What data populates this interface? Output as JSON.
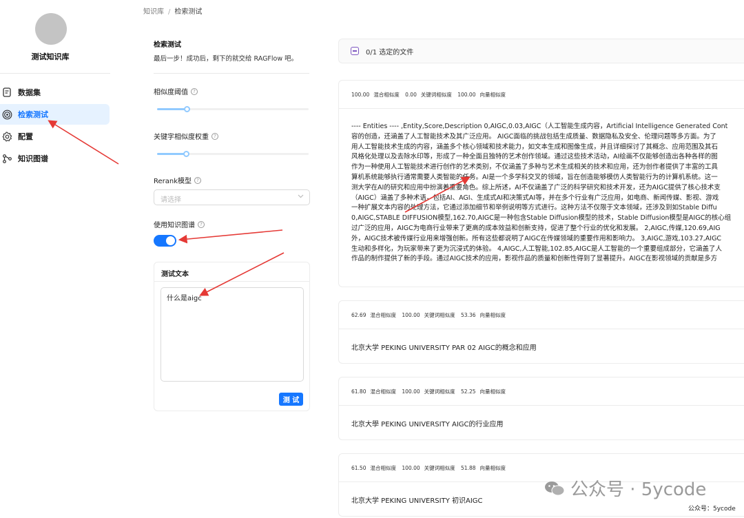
{
  "breadcrumb": {
    "root": "知识库",
    "separator": "/",
    "current": "检索测试"
  },
  "sidebar": {
    "kb_name": "测试知识库",
    "items": [
      {
        "label": "数据集",
        "icon": "document-icon",
        "active": false
      },
      {
        "label": "检索测试",
        "icon": "target-icon",
        "active": true
      },
      {
        "label": "配置",
        "icon": "gear-icon",
        "active": false
      },
      {
        "label": "知识图谱",
        "icon": "graph-icon",
        "active": false
      }
    ]
  },
  "panel": {
    "title": "检索测试",
    "subtitle": "最后一步！成功后，剩下的就交给 RAGFlow 吧。",
    "similarity_threshold_label": "相似度阈值",
    "similarity_threshold_value": 0.2,
    "keyword_weight_label": "关键字相似度权重",
    "keyword_weight_value": 0.2,
    "rerank_label": "Rerank模型",
    "rerank_placeholder": "请选择",
    "knowledge_graph_label": "使用知识图谱",
    "knowledge_graph_enabled": true,
    "test_text_title": "测试文本",
    "test_text_value": "什么是aigc",
    "test_button": "测 试",
    "help_icon": "?"
  },
  "results": {
    "selected_files": "0/1  选定的文件",
    "items": [
      {
        "hybrid": "100.00",
        "hybrid_label": "混合相似度",
        "keyword": "0.00",
        "keyword_label": "关键词相似度",
        "vector": "100.00",
        "vector_label": "向量相似度",
        "lines": [
          "---- Entities ---- ,Entity,Score,Description 0,AIGC,0.03,AIGC（人工智能生成内容，Artificial Intelligence Generated Cont",
          "容的创造，还涵盖了人工智能技术及其广泛应用。 AIGC面临的挑战包括生成质量、数据隐私及安全、伦理问题等多方面。为了",
          "用人工智能技术生成的内容，涵盖多个核心领域和技术能力，如文本生成和图像生成，并且详细探讨了其概念、应用范围及其石",
          "风格化处理以及去除水印等，形成了一种全面且独特的艺术创作领域。通过这些技术活动，AI绘画不仅能够创造出各种各样的图",
          "作为一种使用人工智能技术进行创作的艺术类别，不仅涵盖了多种与艺术生成相关的技术和应用，还为创作者提供了丰富的工具",
          "算机系统能够执行通常需要人类智能的任务。AI是一个多学科交叉的领域，旨在创造能够模仿人类智能行为的计算机系统。这一",
          "测大学在AI的研究和应用中扮演着重要角色。综上所述，AI不仅涵盖了广泛的科学研究和技术开发，还为AIGC提供了核心技术支",
          "（AIGC）涵盖了多种术语，包括AI、AGI、生成式AI和决策式AI等，并在多个行业有广泛应用，如电商、新闻传媒、影视、游戏",
          "一种扩展文本内容的处理方法，它通过添加细节和举例说明等方式进行。这种方法不仅限于文本领域，还涉及到如Stable Diffu",
          "0,AIGC,STABLE DIFFUSION模型,162.70,AIGC是一种包含Stable Diffusion模型的技术，Stable Diffusion模型是AIGC的核心组",
          "过广泛的应用，AIGC为电商行业带来了更高的成本效益和创新支持，促进了整个行业的优化和发展。 2,AIGC,传媒,120.69,AIG",
          "外，AIGC技术被传媒行业用来增强创新。所有这些都说明了AIGC在传媒领域的重要作用和影响力。 3,AIGC,游戏,103.27,AIGC",
          "生动和多样化，为玩家带来了更为沉浸式的体验。 4,AIGC,人工智能,102.85,AIGC是人工智能的一个重要组成部分，它涵盖了人",
          "作品的制作提供了新的手段。通过AIGC技术的应用，影视作品的质量和创新性得到了显著提升。AIGC在影视领域的贡献是多方"
        ]
      },
      {
        "hybrid": "62.69",
        "hybrid_label": "混合相似度",
        "keyword": "100.00",
        "keyword_label": "关键词相似度",
        "vector": "53.36",
        "vector_label": "向量相似度",
        "text": "北京大学 PEKING UNIVERSITY PAR 02 AIGC的概念和应用"
      },
      {
        "hybrid": "61.80",
        "hybrid_label": "混合相似度",
        "keyword": "100.00",
        "keyword_label": "关键词相似度",
        "vector": "52.25",
        "vector_label": "向量相似度",
        "text": "北京大學 PEKING UNIVERSITY AIGC的行业应用"
      },
      {
        "hybrid": "61.50",
        "hybrid_label": "混合相似度",
        "keyword": "100.00",
        "keyword_label": "关键词相似度",
        "vector": "51.88",
        "vector_label": "向量相似度",
        "text": "北京大学 PEKING UNIVERSITY 初识AIGC"
      }
    ]
  },
  "watermark": {
    "text": "公众号 · 5ycode",
    "small": "公众号：5ycode"
  },
  "colors": {
    "accent": "#1677ff",
    "active_bg": "#e6f2ff",
    "arrow": "#e53935",
    "select_box": "#7e57c2"
  }
}
